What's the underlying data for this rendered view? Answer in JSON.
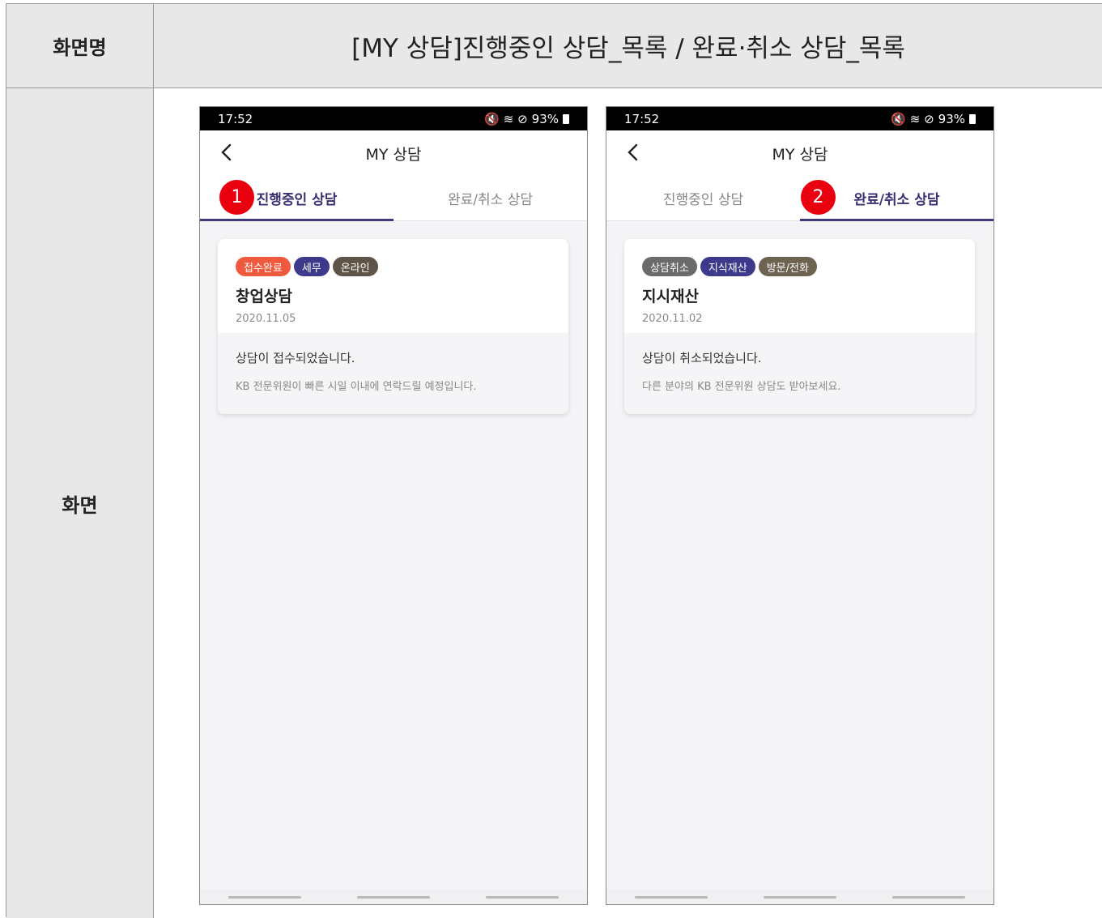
{
  "header": {
    "label": "화면명",
    "title": "[MY 상담]진행중인 상담_목록 / 완료·취소 상담_목록"
  },
  "body": {
    "label": "화면"
  },
  "phones": [
    {
      "status": {
        "time": "17:52",
        "icons": "🔇 ≋ ⊘",
        "battery": "93%"
      },
      "title": "MY 상담",
      "tabs": [
        "진행중인 상담",
        "완료/취소 상담"
      ],
      "active_tab": 0,
      "marker": "1",
      "card": {
        "badges": [
          {
            "label": "접수완료",
            "color": "#ef5a3e"
          },
          {
            "label": "세무",
            "color": "#3d3a8c"
          },
          {
            "label": "온라인",
            "color": "#5e5548"
          }
        ],
        "title": "창업상담",
        "date": "2020.11.05",
        "message": "상담이 접수되었습니다.",
        "submessage": "KB 전문위원이 빠른 시일 이내에 연락드릴 예정입니다."
      }
    },
    {
      "status": {
        "time": "17:52",
        "icons": "🔇 ≋ ⊘",
        "battery": "93%"
      },
      "title": "MY 상담",
      "tabs": [
        "진행중인 상담",
        "완료/취소 상담"
      ],
      "active_tab": 1,
      "marker": "2",
      "card": {
        "badges": [
          {
            "label": "상담취소",
            "color": "#6b6b6b"
          },
          {
            "label": "지식재산",
            "color": "#3d3a8c"
          },
          {
            "label": "방문/전화",
            "color": "#6e6250"
          }
        ],
        "title": "지시재산",
        "date": "2020.11.02",
        "message": "상담이 취소되었습니다.",
        "submessage": "다른 분야의 KB 전문위원 상담도 받아보세요."
      }
    }
  ]
}
